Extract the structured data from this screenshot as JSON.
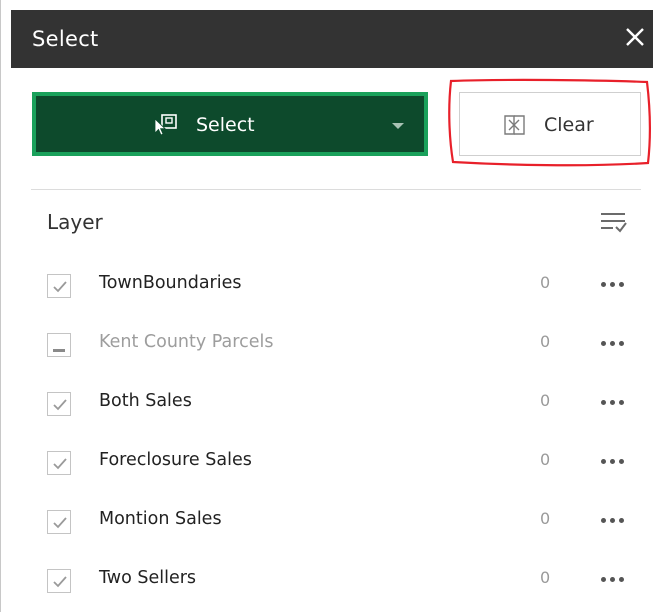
{
  "panel": {
    "title": "Select",
    "close_icon": "close-icon"
  },
  "toolbar": {
    "select_label": "Select",
    "select_icon": "select-cursor-icon",
    "clear_label": "Clear",
    "clear_icon": "clear-selection-icon"
  },
  "colors": {
    "header_bg": "#333333",
    "select_bg": "#0d4a2c",
    "select_border": "#1aa15b",
    "annotation": "#e8202a"
  },
  "layers": {
    "title": "Layer",
    "sort_icon": "sort-filter-icon",
    "items": [
      {
        "name": "TownBoundaries",
        "count": "0",
        "checked": true,
        "enabled": true
      },
      {
        "name": "Kent County Parcels",
        "count": "0",
        "checked": false,
        "enabled": false
      },
      {
        "name": "Both Sales",
        "count": "0",
        "checked": true,
        "enabled": true
      },
      {
        "name": "Foreclosure Sales",
        "count": "0",
        "checked": true,
        "enabled": true
      },
      {
        "name": "Montion Sales",
        "count": "0",
        "checked": true,
        "enabled": true
      },
      {
        "name": "Two Sellers",
        "count": "0",
        "checked": true,
        "enabled": true
      }
    ]
  }
}
